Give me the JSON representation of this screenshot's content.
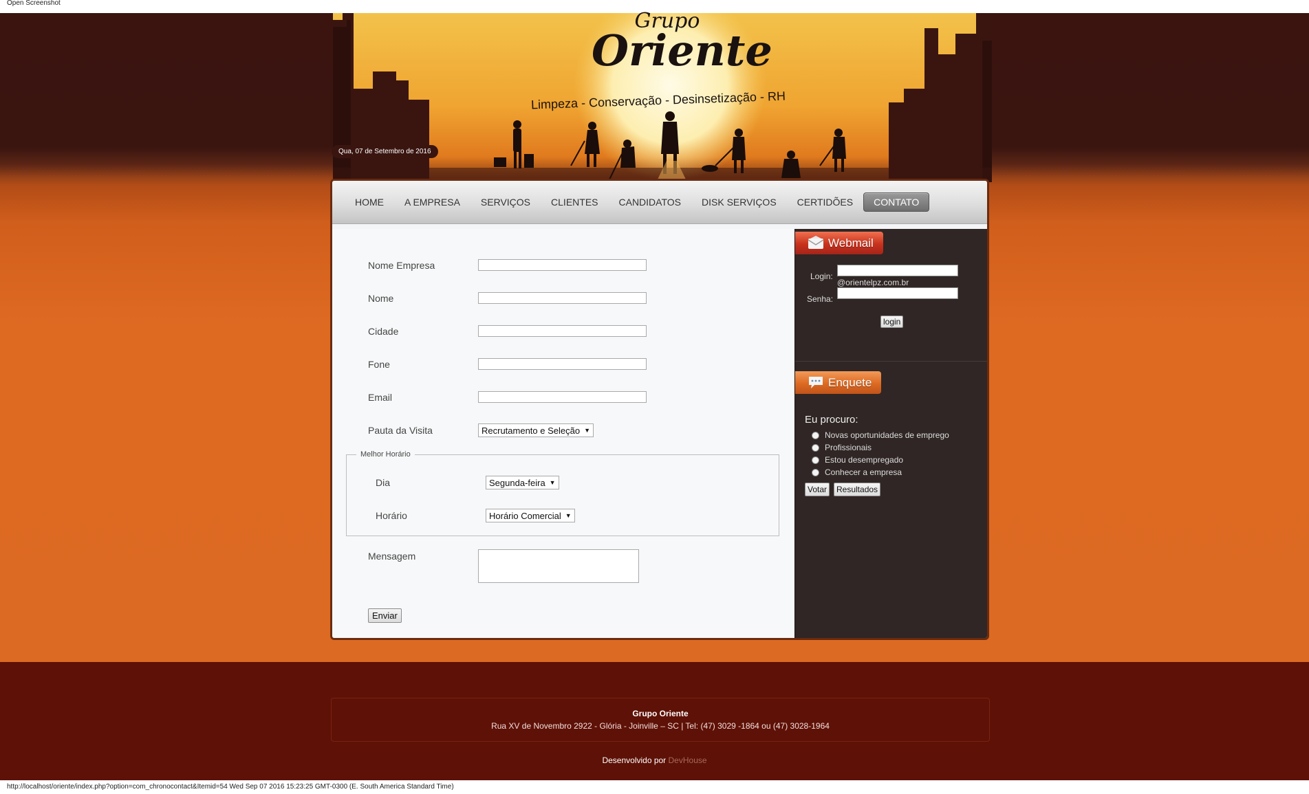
{
  "window": {
    "caption": "Open Screenshot"
  },
  "status_bar": {
    "text": "http://localhost/oriente/index.php?option=com_chronocontact&Itemid=54 Wed Sep 07 2016 15:23:25 GMT-0300 (E. South America Standard Time)"
  },
  "banner": {
    "brand_small": "Grupo",
    "brand_large": "Oriente",
    "tagline": "Limpeza - Conservação - Desinsetização - RH",
    "date": "Qua, 07 de Setembro de 2016"
  },
  "nav": {
    "items": [
      {
        "label": "HOME"
      },
      {
        "label": "A EMPRESA"
      },
      {
        "label": "SERVIÇOS"
      },
      {
        "label": "CLIENTES"
      },
      {
        "label": "CANDIDATOS"
      },
      {
        "label": "DISK SERVIÇOS"
      },
      {
        "label": "CERTIDÕES"
      },
      {
        "label": "CONTATO"
      }
    ],
    "active": "CONTATO"
  },
  "form": {
    "fields": [
      {
        "label": "Nome Empresa",
        "value": ""
      },
      {
        "label": "Nome",
        "value": ""
      },
      {
        "label": "Cidade",
        "value": ""
      },
      {
        "label": "Fone",
        "value": ""
      },
      {
        "label": "Email",
        "value": ""
      }
    ],
    "pauta": {
      "label": "Pauta da Visita",
      "value": "Recrutamento e Seleção"
    },
    "horario_group": {
      "legend": "Melhor Horário",
      "dia": {
        "label": "Dia",
        "value": "Segunda-feira"
      },
      "horario": {
        "label": "Horário",
        "value": "Horário Comercial"
      }
    },
    "mensagem": {
      "label": "Mensagem",
      "value": ""
    },
    "submit": "Enviar"
  },
  "webmail": {
    "title": "Webmail",
    "login_label": "Login:",
    "domain": "@orientelpz.com.br",
    "senha_label": "Senha:",
    "button": "login"
  },
  "enquete": {
    "title": "Enquete",
    "question": "Eu procuro:",
    "options": [
      "Novas oportunidades de emprego",
      "Profissionais",
      "Estou desempregado",
      "Conhecer a empresa"
    ],
    "vote_button": "Votar",
    "results_button": "Resultados"
  },
  "footer": {
    "company": "Grupo Oriente",
    "address": "Rua XV de Novembro 2922 - Glória - Joinville – SC | Tel: (47) 3029 -1864 ou (47) 3028-1964",
    "dev_prefix": "Desenvolvido por",
    "dev_link": "DevHouse"
  },
  "colors": {
    "header_bg": "#3a1510",
    "body_bg": "#dd6a22",
    "footer_bg": "#5e1106",
    "webmail_accent": "#c8321c",
    "enquete_accent": "#dd6a22"
  }
}
